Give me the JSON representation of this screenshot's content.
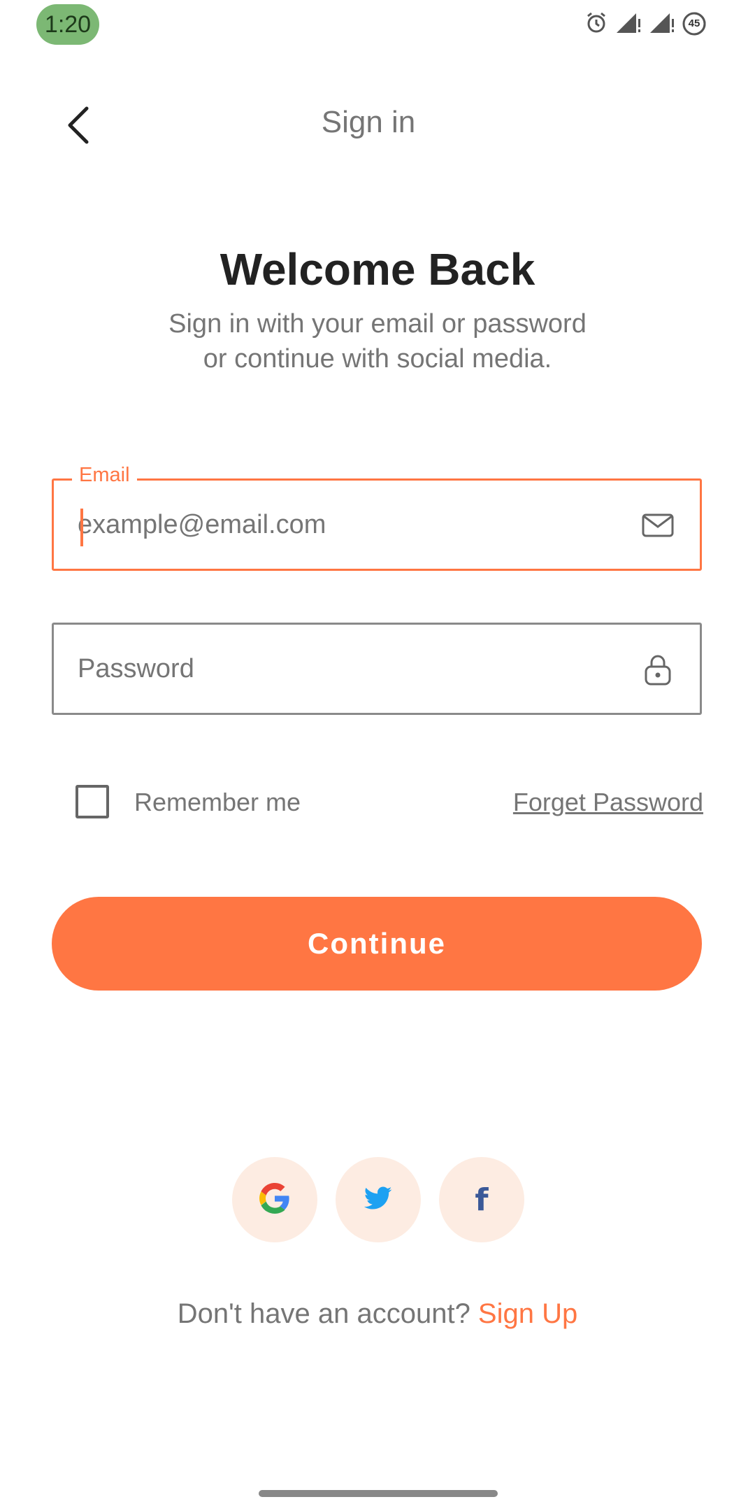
{
  "status_bar": {
    "time": "1:20",
    "battery": "45",
    "icons": [
      "alarm-icon",
      "signal-icon",
      "signal-icon",
      "battery-icon"
    ]
  },
  "header": {
    "title": "Sign in",
    "back_icon": "chevron-left-icon"
  },
  "welcome": {
    "title": "Welcome Back",
    "subtitle_line1": "Sign in with your email or password",
    "subtitle_line2": "or continue with social media."
  },
  "form": {
    "email": {
      "label": "Email",
      "placeholder": "example@email.com",
      "value": "",
      "icon": "mail-icon",
      "focused": true
    },
    "password": {
      "placeholder": "Password",
      "value": "",
      "icon": "lock-icon"
    },
    "remember_label": "Remember me",
    "remember_checked": false,
    "forgot_label": "Forget Password",
    "continue_label": "Continue"
  },
  "social": [
    {
      "name": "google",
      "icon": "google-icon"
    },
    {
      "name": "twitter",
      "icon": "twitter-icon"
    },
    {
      "name": "facebook",
      "icon": "facebook-icon",
      "glyph": "f"
    }
  ],
  "signup": {
    "prompt": "Don't have an account? ",
    "link": "Sign Up"
  },
  "colors": {
    "accent": "#ff7643",
    "social_bg": "#fdece2",
    "status_time_bg": "#7cb874"
  }
}
